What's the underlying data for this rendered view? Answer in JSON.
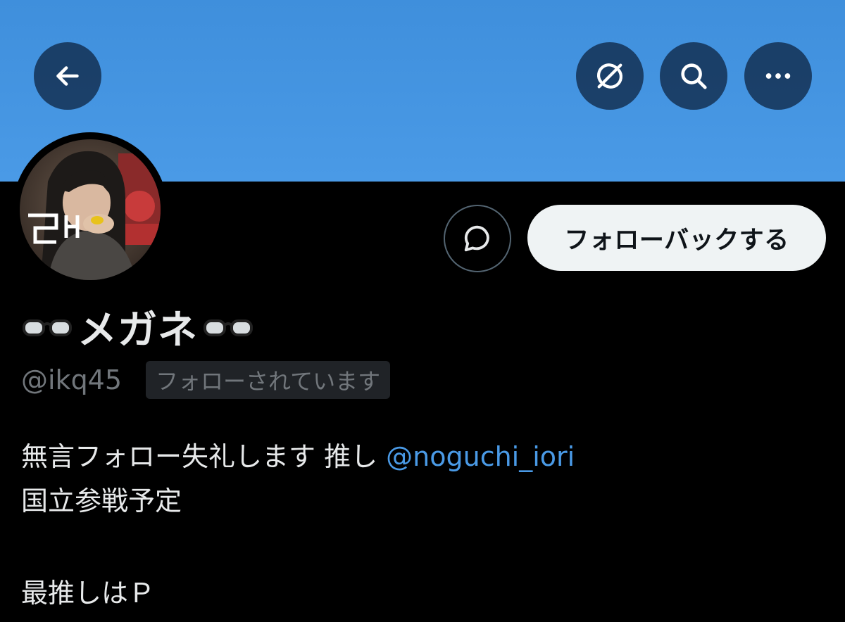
{
  "header": {
    "back_icon": "arrow-left-icon",
    "grok_icon": "grok-icon",
    "search_icon": "search-icon",
    "more_icon": "more-horizontal-icon",
    "banner_color": "#4a9ae6"
  },
  "profile": {
    "display_name": "メガネ",
    "name_emoji": "glasses-emoji",
    "handle": "@ikq45",
    "follows_you_badge": "フォローされています",
    "follow_button_label": "フォローバックする",
    "message_icon": "message-bubble-icon"
  },
  "bio": {
    "line1_text": "無言フォロー失礼します 推し ",
    "line1_mention": "@noguchi_iori",
    "line2": "国立参戦予定",
    "line4": "最推しはＰ"
  },
  "colors": {
    "background": "#000000",
    "link": "#4a9ae6",
    "secondary_text": "#71767b",
    "button_bg": "#eff3f4"
  }
}
